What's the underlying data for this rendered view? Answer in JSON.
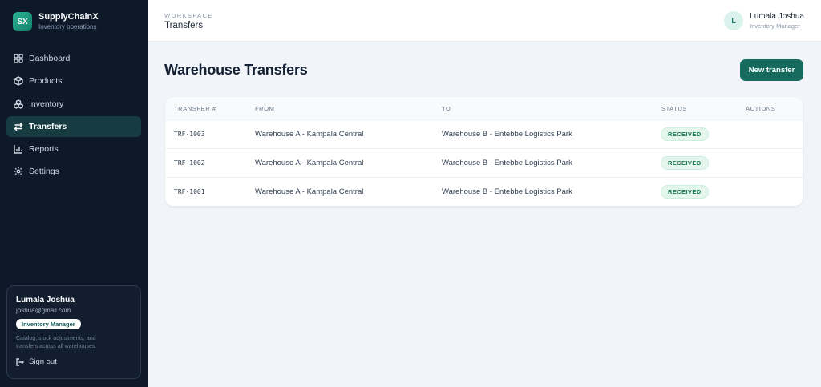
{
  "brand": {
    "logo_text": "SX",
    "name": "SupplyChainX",
    "subtitle": "Inventory operations"
  },
  "sidebar": {
    "items": [
      {
        "label": "Dashboard",
        "icon": "grid-icon",
        "active": false
      },
      {
        "label": "Products",
        "icon": "box-icon",
        "active": false
      },
      {
        "label": "Inventory",
        "icon": "boxes-icon",
        "active": false
      },
      {
        "label": "Transfers",
        "icon": "arrows-swap-icon",
        "active": true
      },
      {
        "label": "Reports",
        "icon": "bar-chart-icon",
        "active": false
      },
      {
        "label": "Settings",
        "icon": "gear-icon",
        "active": false
      }
    ],
    "user_card": {
      "name": "Lumala Joshua",
      "email": "joshua@gmail.com",
      "role": "Inventory Manager",
      "description": "Catalog, stock adjustments, and transfers across all warehouses.",
      "signout_label": "Sign out"
    }
  },
  "header": {
    "crumb_label": "WORKSPACE",
    "crumb_title": "Transfers",
    "user": {
      "avatar_initial": "L",
      "name": "Lumala Joshua",
      "role": "Inventory Manager"
    }
  },
  "main": {
    "title": "Warehouse Transfers",
    "new_button": "New transfer",
    "table": {
      "columns": [
        "TRANSFER #",
        "FROM",
        "TO",
        "STATUS",
        "ACTIONS"
      ],
      "rows": [
        {
          "id": "TRF-1003",
          "from": "Warehouse A - Kampala Central",
          "to": "Warehouse B - Entebbe Logistics Park",
          "status": "RECEIVED"
        },
        {
          "id": "TRF-1002",
          "from": "Warehouse A - Kampala Central",
          "to": "Warehouse B - Entebbe Logistics Park",
          "status": "RECEIVED"
        },
        {
          "id": "TRF-1001",
          "from": "Warehouse A - Kampala Central",
          "to": "Warehouse B - Entebbe Logistics Park",
          "status": "RECEIVED"
        }
      ]
    }
  },
  "colors": {
    "sidebar_bg": "#0d1828",
    "accent": "#166a5e",
    "active_nav": "#163c41",
    "badge_text": "#177a4f"
  }
}
